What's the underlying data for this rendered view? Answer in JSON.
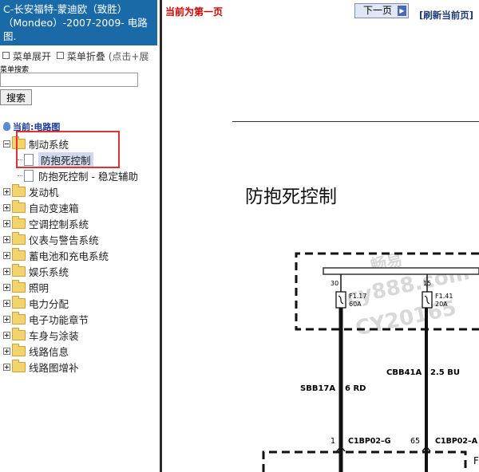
{
  "sidebar": {
    "title": "C-长安福特-蒙迪欧（致胜）（Mondeo）-2007-2009- 电路图.",
    "menu_expand": "菜单展开",
    "menu_collapse": "菜单折叠",
    "menu_hint": "(点击+展",
    "search_label": "菜单搜索",
    "search_placeholder": "",
    "search_button": "搜索",
    "current_label": "当前:电路图",
    "tree": {
      "braking": "制动系统",
      "abs": "防抱死控制",
      "abs_stability": "防抱死控制 - 稳定辅助",
      "engine": "发动机",
      "auto_trans": "自动变速箱",
      "ac": "空调控制系统",
      "instruments": "仪表与警告系统",
      "battery": "蓄电池和充电系统",
      "entertainment": "娱乐系统",
      "lighting": "照明",
      "power_dist": "电力分配",
      "electronic": "电子功能章节",
      "body": "车身与涂装",
      "wiring_info": "线路信息",
      "supplement": "线路图增补"
    }
  },
  "viewer": {
    "page_status": "当前为第一页",
    "next_button": "下一页",
    "refresh": "[刷新当前页]",
    "diagram_title": "防抱死控制",
    "diagram": {
      "fuse1_pin": "30",
      "fuse1_name": "F1.17",
      "fuse1_amp": "60A",
      "fuse2_pin": "15",
      "fuse2_name": "F1.41",
      "fuse2_amp": "20A",
      "wire1_label": "SBB17A",
      "wire1_spec": "6 RD",
      "wire2_label": "CBB41A",
      "wire2_spec": "2.5 BU",
      "conn1_pin": "1",
      "conn1_name": "C1BP02–G",
      "conn2_pin": "65",
      "conn2_name": "C1BP02–A",
      "edge_letter": "F",
      "watermark1": "畅易",
      "watermark2": "cy888.com",
      "watermark3": "CY20165"
    }
  },
  "colors": {
    "title_bg": "#1a6aa8",
    "highlight": "#e53030",
    "page_status": "#d00000"
  }
}
